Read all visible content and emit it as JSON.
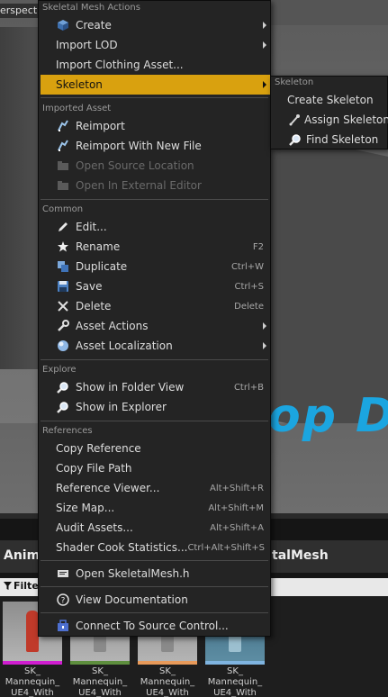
{
  "viewport": {
    "mode_label": "erspective",
    "watermark": "op D"
  },
  "content_browser": {
    "title_left": "Anima",
    "title_right": "talMesh",
    "filter_label": "Filter",
    "assets": [
      {
        "line1": "SK_",
        "line2": "Mannequin_",
        "line3": "UE4_With",
        "bar_color": "#d01ed0"
      },
      {
        "line1": "SK_",
        "line2": "Mannequin_",
        "line3": "UE4_With",
        "bar_color": "#5e8f3e"
      },
      {
        "line1": "SK_",
        "line2": "Mannequin_",
        "line3": "UE4_With",
        "bar_color": "#e89a5a"
      },
      {
        "line1": "SK_",
        "line2": "Mannequin_",
        "line3": "UE4_With",
        "bar_color": "#7fb4e0"
      }
    ]
  },
  "menu": {
    "sections": {
      "skeletal_mesh_actions": "Skeletal Mesh Actions",
      "imported_asset": "Imported Asset",
      "common": "Common",
      "explore": "Explore",
      "references": "References"
    },
    "items": {
      "create": "Create",
      "import_lod": "Import LOD",
      "import_clothing": "Import Clothing Asset...",
      "skeleton": "Skeleton",
      "reimport": "Reimport",
      "reimport_new_file": "Reimport With New File",
      "open_source_location": "Open Source Location",
      "open_external_editor": "Open In External Editor",
      "edit": "Edit...",
      "rename": "Rename",
      "duplicate": "Duplicate",
      "save": "Save",
      "delete": "Delete",
      "asset_actions": "Asset Actions",
      "asset_localization": "Asset Localization",
      "show_folder_view": "Show in Folder View",
      "show_explorer": "Show in Explorer",
      "copy_reference": "Copy Reference",
      "copy_file_path": "Copy File Path",
      "reference_viewer": "Reference Viewer...",
      "size_map": "Size Map...",
      "audit_assets": "Audit Assets...",
      "shader_cook_stats": "Shader Cook Statistics...",
      "open_header": "Open SkeletalMesh.h",
      "view_docs": "View Documentation",
      "connect_source_control": "Connect To Source Control..."
    },
    "shortcuts": {
      "rename": "F2",
      "duplicate": "Ctrl+W",
      "save": "Ctrl+S",
      "delete": "Delete",
      "show_folder_view": "Ctrl+B",
      "reference_viewer": "Alt+Shift+R",
      "size_map": "Alt+Shift+M",
      "audit_assets": "Alt+Shift+A",
      "shader_cook_stats": "Ctrl+Alt+Shift+S"
    }
  },
  "submenu": {
    "header": "Skeleton",
    "items": {
      "create_skeleton": "Create Skeleton",
      "assign_skeleton": "Assign Skeleton",
      "find_skeleton": "Find Skeleton"
    }
  },
  "colors": {
    "highlight": "#d9a10f",
    "menu_bg": "#242424",
    "watermark": "#1ba5e0"
  }
}
